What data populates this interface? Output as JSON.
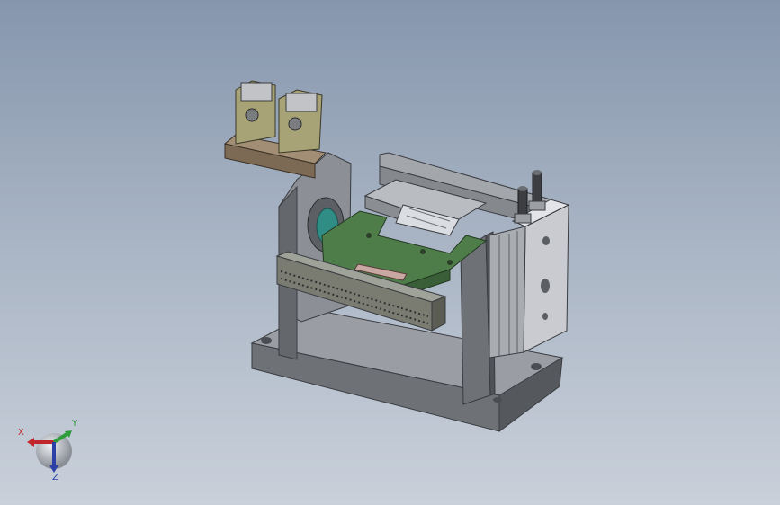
{
  "viewport": {
    "background_top": "#8696ad",
    "background_bottom": "#c9d0da"
  },
  "orientation_triad": {
    "x_label": "X",
    "y_label": "Y",
    "z_label": "Z",
    "x_color": "#c0262b",
    "y_color": "#2f9c3a",
    "z_color": "#2b3fa6"
  },
  "model": {
    "component_icons": [
      "sensor-bracket",
      "sensor-head",
      "support-frame",
      "pneumatic-cylinder",
      "air-fitting",
      "base-plate",
      "slide-table",
      "cable-chain"
    ]
  }
}
